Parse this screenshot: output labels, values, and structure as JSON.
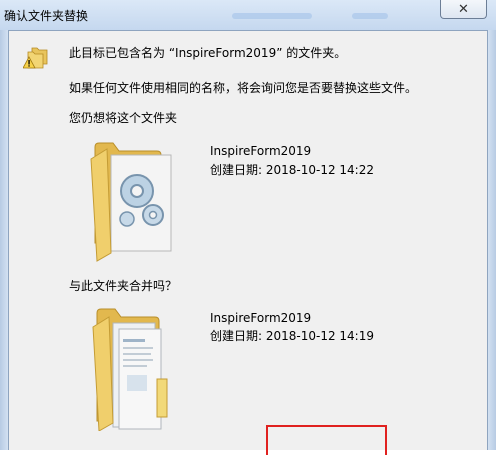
{
  "window": {
    "title": "确认文件夹替换",
    "close_glyph": "✕"
  },
  "dialog": {
    "message": "此目标已包含名为 “InspireForm2019” 的文件夹。",
    "detail": "如果任何文件使用相同的名称，将会询问您是否要替换这些文件。",
    "question": "您仍想将这个文件夹",
    "merge_question": "与此文件夹合并吗？",
    "destination": {
      "name": "InspireForm2019",
      "created": "创建日期: 2018-10-12 14:22"
    },
    "source": {
      "name": "InspireForm2019",
      "created": "创建日期: 2018-10-12 14:19"
    }
  },
  "icons": {
    "warning": "warning-folder-icon",
    "destination_folder": "settings-folder-icon",
    "source_folder": "documents-folder-icon"
  },
  "colors": {
    "highlight": "#e0211f",
    "title_bar": "#c5d8ef"
  }
}
